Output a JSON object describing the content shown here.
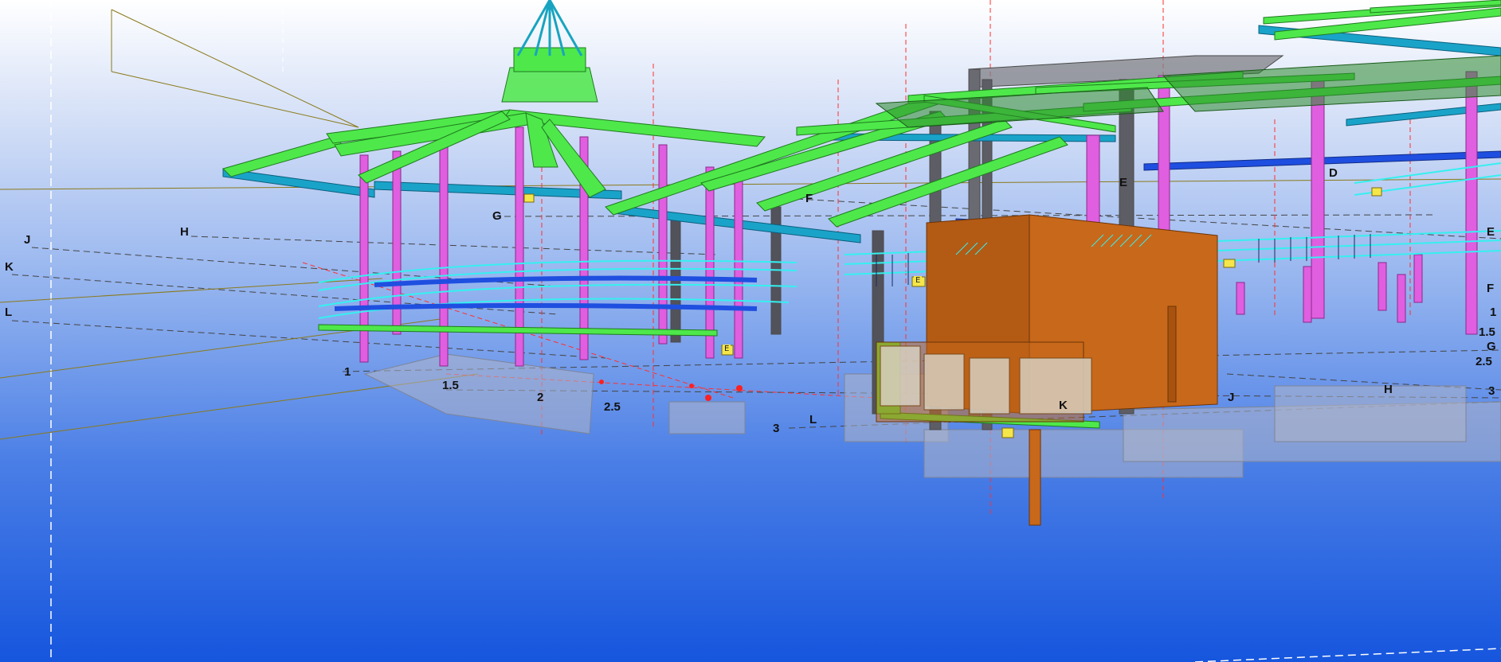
{
  "viewer": {
    "background_top": "#ffffff",
    "background_bottom": "#1656de",
    "member_colors": {
      "beam": "#4ee84a",
      "column": "#e05ee0",
      "secondary_beam": "#1aa3c9",
      "rail": "#35f0f0",
      "brace": "#1f4fe0",
      "panel": "#c8681a",
      "footing": "#b8bccb",
      "grid_line": "#ff3030"
    }
  },
  "grid_labels": {
    "left_j": "J",
    "left_k": "K",
    "left_l": "L",
    "h_upper": "H",
    "g": "G",
    "f": "F",
    "e": "E",
    "d": "D",
    "n1": "1",
    "n1_5": "1.5",
    "n2": "2",
    "n2_5": "2.5",
    "n3": "3",
    "l_mid": "L",
    "k_mid": "K",
    "j_right": "J",
    "h_right": "H",
    "right_1": "1",
    "right_1_5": "1.5",
    "right_g": "G",
    "right_2_5": "2.5",
    "right_3": "3",
    "right_f": "F",
    "right_e": "E"
  },
  "tags": {
    "tag_a": "E",
    "tag_b": "E"
  }
}
